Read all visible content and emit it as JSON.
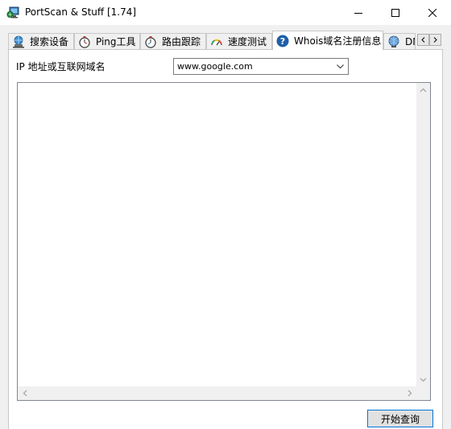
{
  "window": {
    "title": "PortScan & Stuff [1.74]",
    "app_icon": "network-monitor-icon",
    "controls": {
      "minimize": "minimize-icon",
      "maximize": "maximize-icon",
      "close": "close-icon"
    }
  },
  "tabs": [
    {
      "label": "搜索设备",
      "icon": "network-globe-icon",
      "active": false
    },
    {
      "label": "Ping工具",
      "icon": "stopwatch-icon",
      "active": false
    },
    {
      "label": "路由跟踪",
      "icon": "stopwatch-icon",
      "active": false
    },
    {
      "label": "速度测试",
      "icon": "speedometer-icon",
      "active": false
    },
    {
      "label": "Whois域名注册信息",
      "icon": "help-question-icon",
      "active": true
    },
    {
      "label": "DN",
      "icon": "dns-globe-icon",
      "active": false
    }
  ],
  "whois": {
    "host_label": "IP 地址或互联网域名",
    "host_value": "www.google.com",
    "output_text": "",
    "start_button": "开始查询"
  },
  "colors": {
    "accent": "#0078d7",
    "window_bg": "#f0f0f0",
    "panel_bg": "#ffffff"
  }
}
